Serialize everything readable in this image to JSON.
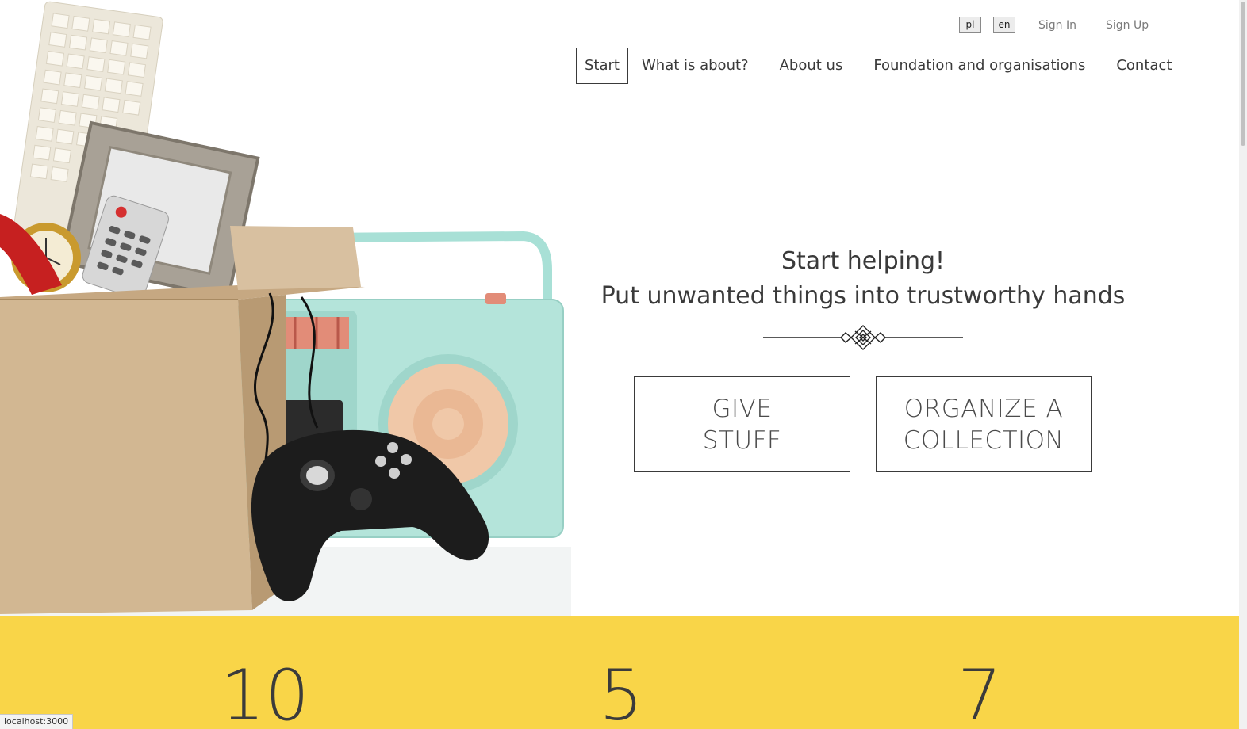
{
  "lang_switch": {
    "pl": "pl",
    "en": "en"
  },
  "auth": {
    "sign_in": "Sign In",
    "sign_up": "Sign Up"
  },
  "nav": {
    "start": "Start",
    "what_is_about": "What is about?",
    "about_us": "About us",
    "foundations": "Foundation and organisations",
    "contact": "Contact"
  },
  "hero": {
    "title_line1": "Start helping!",
    "title_line2": "Put unwanted things into trustworthy hands",
    "give_line1": "GIVE",
    "give_line2": "STUFF",
    "organize_line1": "ORGANIZE A",
    "organize_line2": "COLLECTION"
  },
  "stats": {
    "first": "10",
    "second": "5",
    "third": "7"
  },
  "status_bar": "localhost:3000",
  "colors": {
    "stats_band": "#f9d548",
    "text": "#3a3a3a"
  }
}
